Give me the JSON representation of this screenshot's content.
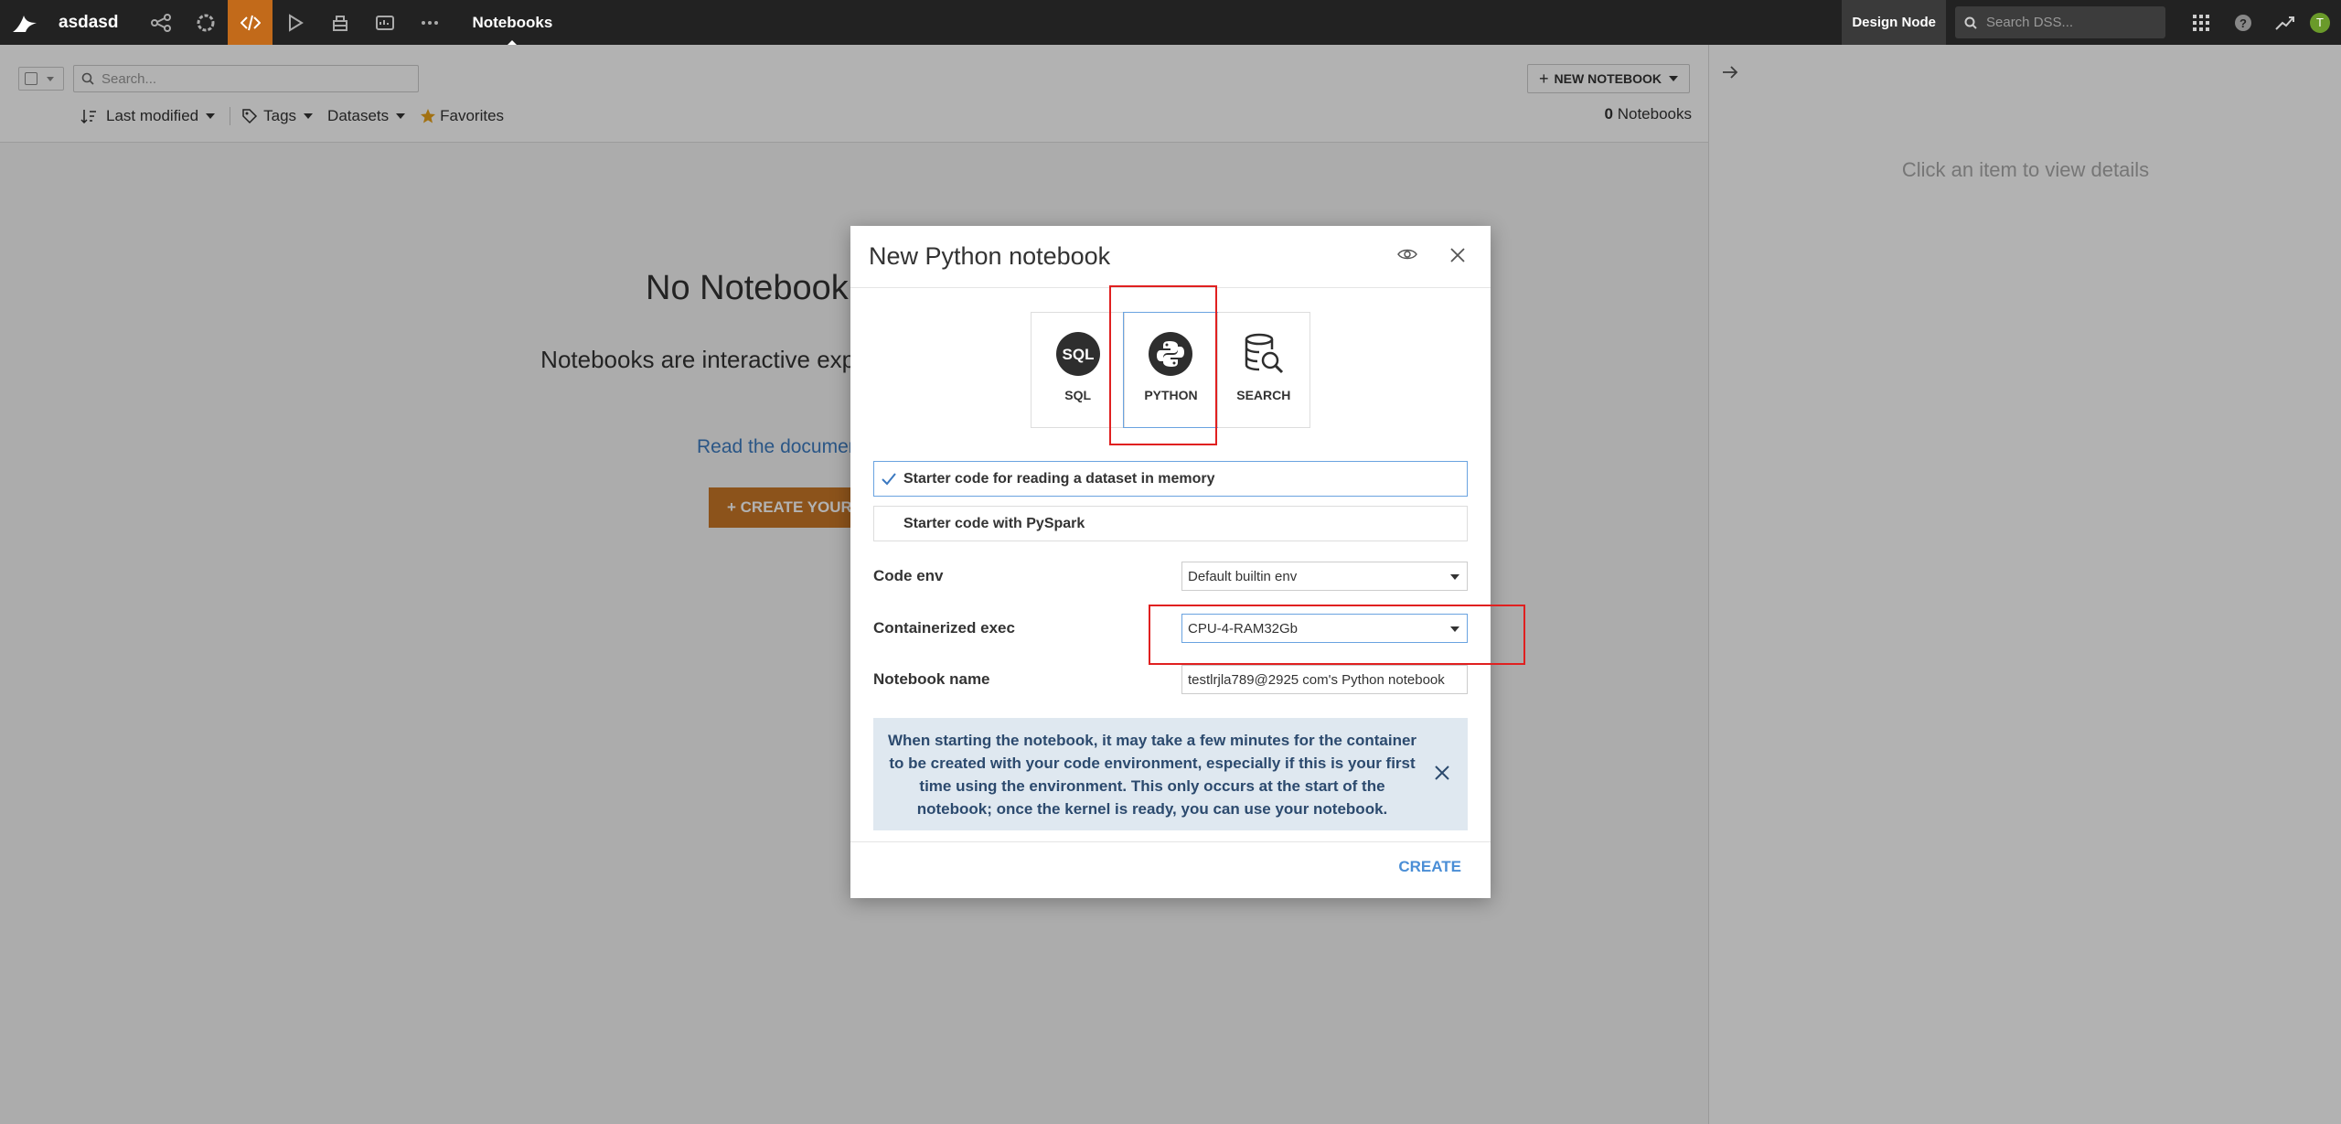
{
  "nav": {
    "project_name": "asdasd",
    "page_title": "Notebooks",
    "node_label": "Design Node",
    "search_placeholder": "Search DSS...",
    "avatar_initial": "T",
    "active_color": "#c26a1a"
  },
  "toolbar": {
    "search_placeholder": "Search...",
    "new_notebook_label": "NEW NOTEBOOK",
    "sort_label": "Last modified",
    "tags_label": "Tags",
    "datasets_label": "Datasets",
    "favorites_label": "Favorites",
    "count_value": "0",
    "count_label": "Notebooks"
  },
  "empty": {
    "title": "No Notebook",
    "description": "Notebooks are interactive exploration and man",
    "read_doc": "Read the documen",
    "create_first": "+ CREATE YOUR F"
  },
  "right_panel": {
    "message": "Click an item to view details"
  },
  "modal": {
    "title": "New Python notebook",
    "types": [
      {
        "label": "SQL"
      },
      {
        "label": "PYTHON"
      },
      {
        "label": "SEARCH"
      }
    ],
    "options": [
      {
        "label": "Starter code for reading a dataset in memory"
      },
      {
        "label": "Starter code with PySpark"
      }
    ],
    "code_env_label": "Code env",
    "code_env_value": "Default builtin env",
    "exec_label": "Containerized exec",
    "exec_value": "CPU-4-RAM32Gb",
    "name_label": "Notebook name",
    "name_value": "testlrjla789@2925 com's Python notebook",
    "info_text": "When starting the notebook, it may take a few minutes for the container to be created with your code environment, especially if this is your first time using the environment. This only occurs at the start of the notebook; once the kernel is ready, you can use your notebook.",
    "create_label": "CREATE"
  }
}
